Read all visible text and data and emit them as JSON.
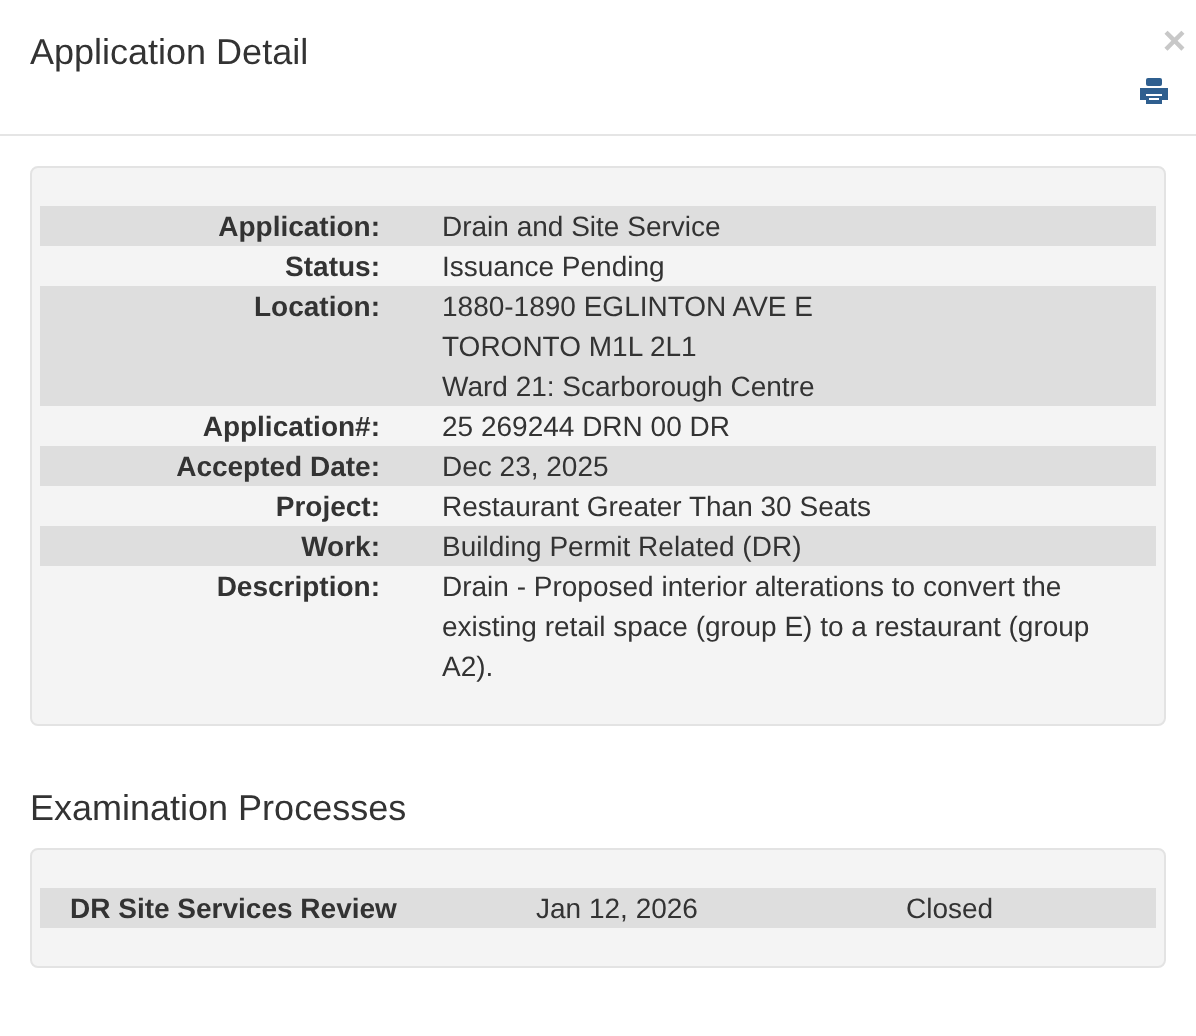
{
  "dialog": {
    "title": "Application Detail",
    "close": "×"
  },
  "details": [
    {
      "label": "Application:",
      "lines": [
        "Drain and Site Service"
      ]
    },
    {
      "label": "Status:",
      "lines": [
        "Issuance Pending"
      ]
    },
    {
      "label": "Location:",
      "lines": [
        "1880-1890 EGLINTON AVE E",
        "TORONTO M1L 2L1",
        "Ward 21: Scarborough Centre"
      ]
    },
    {
      "label": "Application#:",
      "lines": [
        "25 269244 DRN 00 DR"
      ]
    },
    {
      "label": "Accepted Date:",
      "lines": [
        "Dec 23, 2025"
      ]
    },
    {
      "label": "Project:",
      "lines": [
        "Restaurant Greater Than 30 Seats"
      ]
    },
    {
      "label": "Work:",
      "lines": [
        "Building Permit Related (DR)"
      ]
    },
    {
      "label": "Description:",
      "lines": [
        "Drain - Proposed interior alterations to convert the existing retail space (group E) to a restaurant (group A2)."
      ]
    }
  ],
  "examination": {
    "title": "Examination Processes",
    "rows": [
      {
        "name": "DR Site Services Review",
        "date": "Jan 12, 2026",
        "status": "Closed"
      }
    ]
  }
}
